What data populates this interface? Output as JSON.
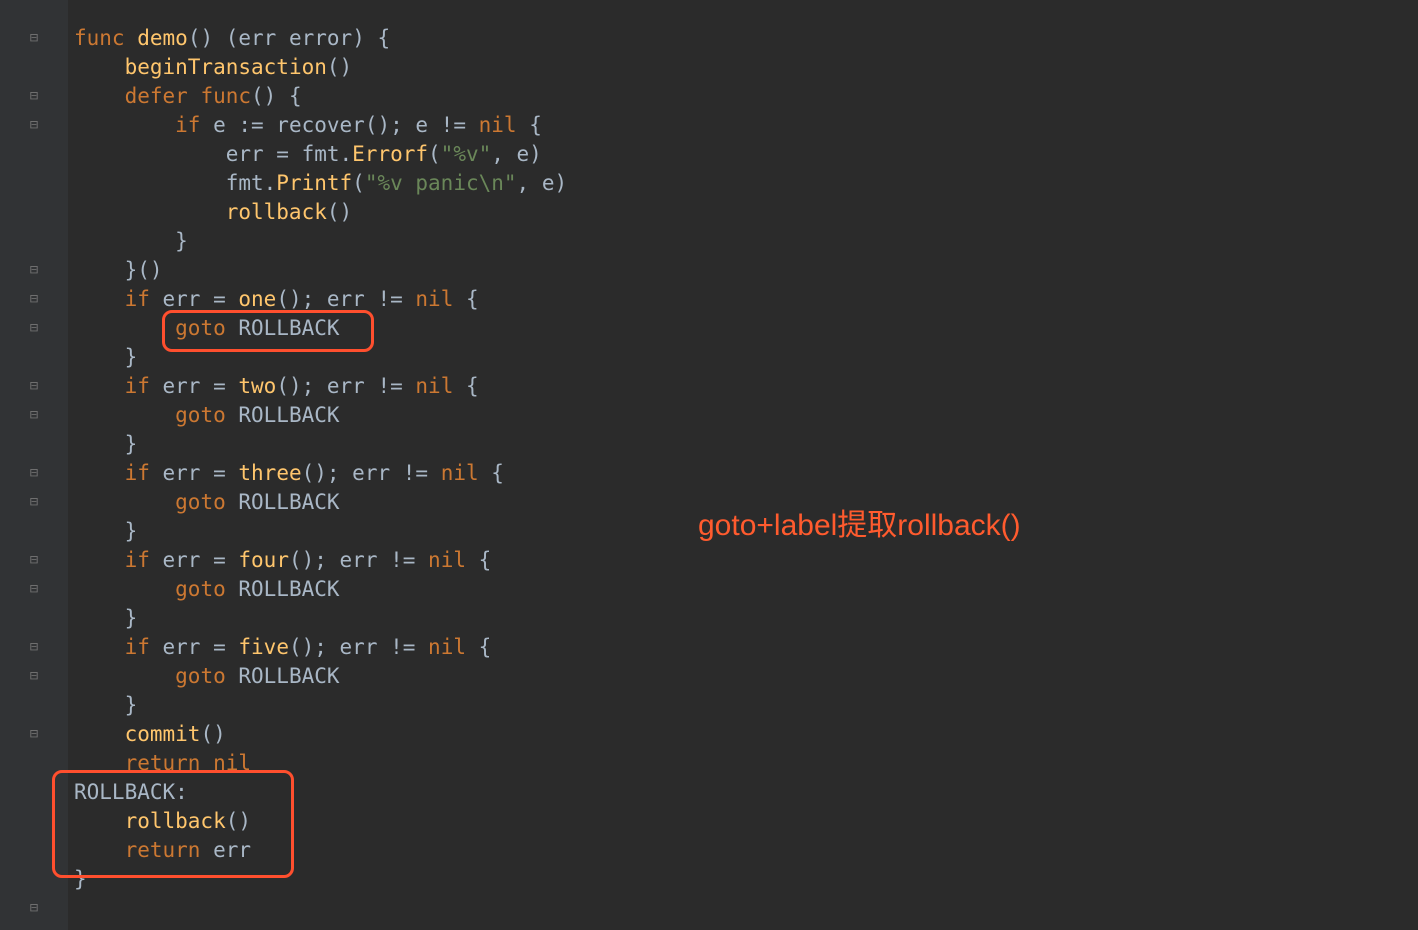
{
  "annotations": {
    "callout_text": "goto+label提取rollback()"
  },
  "gutter_marks": [
    "⊟",
    "",
    "⊟",
    "⊟",
    "",
    "",
    "",
    "",
    "⊟",
    "⊟",
    "⊟",
    "",
    "⊟",
    "⊟",
    "",
    "⊟",
    "⊟",
    "",
    "⊟",
    "⊟",
    "",
    "⊟",
    "⊟",
    "",
    "⊟",
    "",
    "",
    "",
    "",
    "",
    "⊟"
  ],
  "code": {
    "l1": {
      "kw_func": "func",
      "fn_demo": "demo",
      "txt_paren": "() (err ",
      "typ_error": "error",
      "brace": ") {"
    },
    "l2": {
      "fn_begin": "beginTransaction",
      "paren": "()"
    },
    "l3": {
      "kw_defer": "defer",
      "kw_func": "func",
      "txt": "() {"
    },
    "l4": {
      "kw_if": "if",
      "txt_cond": " e := recover(); e != ",
      "kw_nil": "nil",
      "brace": " {"
    },
    "l5": {
      "txt_pre": "err = fmt.",
      "fn_errorf": "Errorf",
      "args_open": "(",
      "str": "\"%v\"",
      "args_rest": ", e)"
    },
    "l6": {
      "txt_pre": "fmt.",
      "fn_printf": "Printf",
      "args_open": "(",
      "str": "\"%v panic\\n\"",
      "args_rest": ", e)"
    },
    "l7": {
      "fn_rollback": "rollback",
      "paren": "()"
    },
    "l8": {
      "brace": "}"
    },
    "l9": {
      "close": "}()"
    },
    "l10": {
      "kw_if": "if",
      "cond_pre": " err = ",
      "fn_one": "one",
      "cond_mid": "(); err != ",
      "kw_nil": "nil",
      "brace": " {"
    },
    "l11": {
      "kw_goto": "goto",
      "lbl": " ROLLBACK"
    },
    "l12": {
      "brace": "}"
    },
    "l13": {
      "kw_if": "if",
      "cond_pre": " err = ",
      "fn": "two",
      "cond_mid": "(); err != ",
      "kw_nil": "nil",
      "brace": " {"
    },
    "l14": {
      "kw_goto": "goto",
      "lbl": " ROLLBACK"
    },
    "l15": {
      "brace": "}"
    },
    "l16": {
      "kw_if": "if",
      "cond_pre": " err = ",
      "fn": "three",
      "cond_mid": "(); err != ",
      "kw_nil": "nil",
      "brace": " {"
    },
    "l17": {
      "kw_goto": "goto",
      "lbl": " ROLLBACK"
    },
    "l18": {
      "brace": "}"
    },
    "l19": {
      "kw_if": "if",
      "cond_pre": " err = ",
      "fn": "four",
      "cond_mid": "(); err != ",
      "kw_nil": "nil",
      "brace": " {"
    },
    "l20": {
      "kw_goto": "goto",
      "lbl": " ROLLBACK"
    },
    "l21": {
      "brace": "}"
    },
    "l22": {
      "kw_if": "if",
      "cond_pre": " err = ",
      "fn": "five",
      "cond_mid": "(); err != ",
      "kw_nil": "nil",
      "brace": " {"
    },
    "l23": {
      "kw_goto": "goto",
      "lbl": " ROLLBACK"
    },
    "l24": {
      "brace": "}"
    },
    "l25": {
      "fn_commit": "commit",
      "paren": "()"
    },
    "l26": {
      "kw_return": "return",
      "kw_nil": " nil"
    },
    "l27": {
      "lbl": "ROLLBACK:"
    },
    "l28": {
      "fn_rollback": "rollback",
      "paren": "()"
    },
    "l29": {
      "kw_return": "return",
      "expr": " err"
    },
    "l30": {
      "brace": "}"
    }
  }
}
